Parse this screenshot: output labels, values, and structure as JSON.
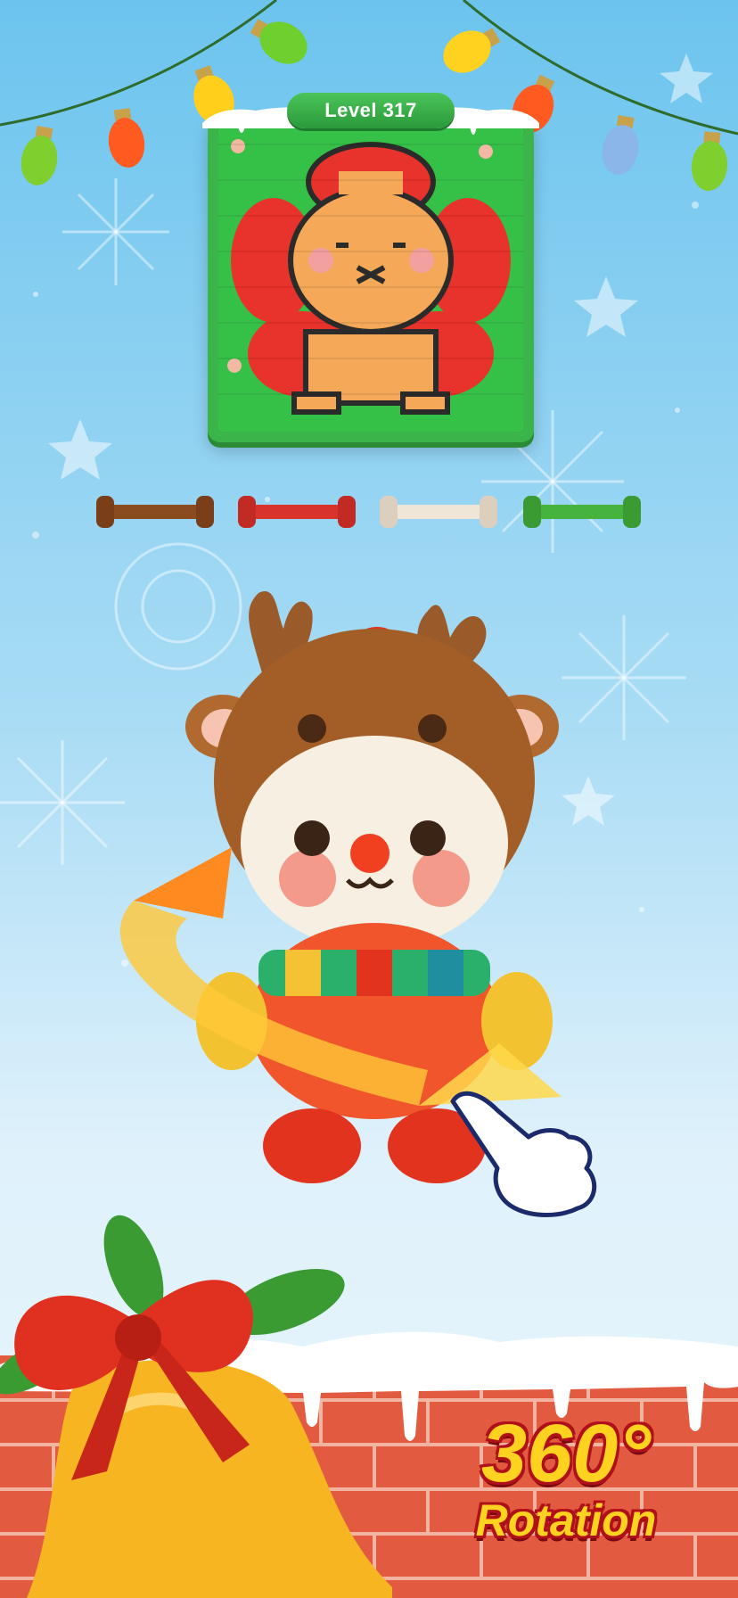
{
  "level": {
    "label": "Level 317"
  },
  "colors": {
    "spools": [
      "#8a4b1f",
      "#d8342c",
      "#efe6d8",
      "#45b33d"
    ],
    "accent_green": "#3bb54a",
    "sky_top": "#6cc4ee"
  },
  "icons": {
    "lights": "christmas-light-icon",
    "hand": "pointing-hand-icon",
    "bell": "bell-icon",
    "bow": "bow-icon",
    "rotate": "rotation-arrow-icon"
  },
  "promo": {
    "number": "360°",
    "text": "Rotation"
  }
}
